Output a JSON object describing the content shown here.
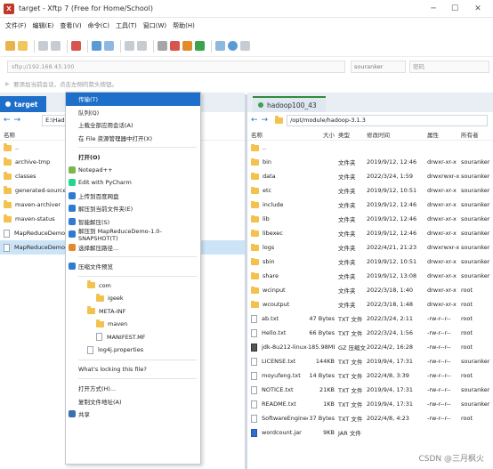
{
  "window": {
    "title": "target - Xftp 7 (Free for Home/School)",
    "app_badge": "X"
  },
  "menubar": [
    "文件(F)",
    "编辑(E)",
    "查看(V)",
    "命令(C)",
    "工具(T)",
    "窗口(W)",
    "帮助(H)"
  ],
  "address": {
    "placeholder": "sftp://192.168.43.100",
    "username_placeholder": "souranker",
    "password_placeholder": "密码"
  },
  "hint": "要添加当前会话，点击左侧的箭头按钮。",
  "left": {
    "tab_label": "target",
    "path": "E:\\HadoopC",
    "col_name": "名称",
    "items": [
      {
        "name": "..",
        "type": "folder"
      },
      {
        "name": "archive-tmp",
        "type": "folder"
      },
      {
        "name": "classes",
        "type": "folder"
      },
      {
        "name": "generated-sources",
        "type": "folder"
      },
      {
        "name": "maven-archiver",
        "type": "folder"
      },
      {
        "name": "maven-status",
        "type": "folder"
      },
      {
        "name": "MapReduceDemo-...",
        "type": "file"
      },
      {
        "name": "MapReduceDemo-...",
        "type": "file"
      }
    ]
  },
  "context_menu": {
    "groups": [
      [
        {
          "label": "传输(T)",
          "highlight": true
        },
        {
          "label": "队列(Q)"
        },
        {
          "label": "上载全部应用会话(A)"
        },
        {
          "label": "在 File 资源管理器中打开(X)"
        }
      ],
      [
        {
          "label": "打开(O)",
          "bold": true
        },
        {
          "label": "Notepad++",
          "icon": "#7bb84a"
        },
        {
          "label": "Edit with PyCharm",
          "icon": "#21d789"
        },
        {
          "label": "上传到百度网盘",
          "icon": "#2e7bd1"
        },
        {
          "label": "解压到当前文件夹(E)",
          "icon": "#2e7bd1"
        },
        {
          "label": "智能解压(S)",
          "icon": "#2e7bd1"
        },
        {
          "label": "解压到 MapReduceDemo-1.0-SNAPSHOT(T)",
          "icon": "#2e7bd1"
        },
        {
          "label": "选择解压路径...",
          "icon": "#e38a2b"
        }
      ],
      [
        {
          "label": "压缩文件预览",
          "icon": "#2e7bd1"
        }
      ],
      [
        {
          "label": "com",
          "folder": true,
          "indent": 1
        },
        {
          "label": "igeek",
          "folder": true,
          "indent": 2
        },
        {
          "label": "META-INF",
          "folder": true,
          "indent": 1
        },
        {
          "label": "maven",
          "folder": true,
          "indent": 2
        },
        {
          "label": "MANIFEST.MF",
          "file": true,
          "indent": 2
        },
        {
          "label": "log4j.properties",
          "file": true,
          "indent": 1
        }
      ],
      [
        {
          "label": "What's locking this file?"
        }
      ],
      [
        {
          "label": "打开方式(H)..."
        },
        {
          "label": "复制文件地址(A)"
        },
        {
          "label": "共享",
          "icon": "#3a6fb0"
        }
      ]
    ]
  },
  "right": {
    "tab_label": "hadoop100_43",
    "path": "/opt/module/hadoop-3.1.3",
    "columns": [
      "名称",
      "大小",
      "类型",
      "修改时间",
      "属性",
      "所有者"
    ],
    "rows": [
      {
        "name": "..",
        "size": "",
        "type": "",
        "mtime": "",
        "attr": "",
        "owner": "",
        "icon": "folder"
      },
      {
        "name": "bin",
        "size": "",
        "type": "文件夹",
        "mtime": "2019/9/12, 12:46",
        "attr": "drwxr-xr-x",
        "owner": "souranker",
        "icon": "folder"
      },
      {
        "name": "data",
        "size": "",
        "type": "文件夹",
        "mtime": "2022/3/24, 1:59",
        "attr": "drwxrwxr-x",
        "owner": "souranker",
        "icon": "folder"
      },
      {
        "name": "etc",
        "size": "",
        "type": "文件夹",
        "mtime": "2019/9/12, 10:51",
        "attr": "drwxr-xr-x",
        "owner": "souranker",
        "icon": "folder"
      },
      {
        "name": "include",
        "size": "",
        "type": "文件夹",
        "mtime": "2019/9/12, 12:46",
        "attr": "drwxr-xr-x",
        "owner": "souranker",
        "icon": "folder"
      },
      {
        "name": "lib",
        "size": "",
        "type": "文件夹",
        "mtime": "2019/9/12, 12:46",
        "attr": "drwxr-xr-x",
        "owner": "souranker",
        "icon": "folder"
      },
      {
        "name": "libexec",
        "size": "",
        "type": "文件夹",
        "mtime": "2019/9/12, 12:46",
        "attr": "drwxr-xr-x",
        "owner": "souranker",
        "icon": "folder"
      },
      {
        "name": "logs",
        "size": "",
        "type": "文件夹",
        "mtime": "2022/4/21, 21:23",
        "attr": "drwxrwxr-x",
        "owner": "souranker",
        "icon": "folder"
      },
      {
        "name": "sbin",
        "size": "",
        "type": "文件夹",
        "mtime": "2019/9/12, 10:51",
        "attr": "drwxr-xr-x",
        "owner": "souranker",
        "icon": "folder"
      },
      {
        "name": "share",
        "size": "",
        "type": "文件夹",
        "mtime": "2019/9/12, 13:08",
        "attr": "drwxr-xr-x",
        "owner": "souranker",
        "icon": "folder"
      },
      {
        "name": "wcinput",
        "size": "",
        "type": "文件夹",
        "mtime": "2022/3/18, 1:40",
        "attr": "drwxr-xr-x",
        "owner": "root",
        "icon": "folder"
      },
      {
        "name": "wcoutput",
        "size": "",
        "type": "文件夹",
        "mtime": "2022/3/18, 1:48",
        "attr": "drwxr-xr-x",
        "owner": "root",
        "icon": "folder"
      },
      {
        "name": "ab.txt",
        "size": "47 Bytes",
        "type": "TXT 文件",
        "mtime": "2022/3/24, 2:11",
        "attr": "-rw-r--r--",
        "owner": "root",
        "icon": "file"
      },
      {
        "name": "Hello.txt",
        "size": "66 Bytes",
        "type": "TXT 文件",
        "mtime": "2022/3/24, 1:56",
        "attr": "-rw-r--r--",
        "owner": "root",
        "icon": "file"
      },
      {
        "name": "jdk-8u212-linux-x64....",
        "size": "185.98MB",
        "type": "GZ 压缩文...",
        "mtime": "2022/4/2, 16:28",
        "attr": "-rw-r--r--",
        "owner": "root",
        "icon": "dark"
      },
      {
        "name": "LICENSE.txt",
        "size": "144KB",
        "type": "TXT 文件",
        "mtime": "2019/9/4, 17:31",
        "attr": "-rw-r--r--",
        "owner": "souranker",
        "icon": "file"
      },
      {
        "name": "moyufeng.txt",
        "size": "14 Bytes",
        "type": "TXT 文件",
        "mtime": "2022/4/8, 3:39",
        "attr": "-rw-r--r--",
        "owner": "root",
        "icon": "file"
      },
      {
        "name": "NOTICE.txt",
        "size": "21KB",
        "type": "TXT 文件",
        "mtime": "2019/9/4, 17:31",
        "attr": "-rw-r--r--",
        "owner": "souranker",
        "icon": "file"
      },
      {
        "name": "README.txt",
        "size": "1KB",
        "type": "TXT 文件",
        "mtime": "2019/9/4, 17:31",
        "attr": "-rw-r--r--",
        "owner": "souranker",
        "icon": "file"
      },
      {
        "name": "SoftwareEngineerin...",
        "size": "37 Bytes",
        "type": "TXT 文件",
        "mtime": "2022/4/8, 4:23",
        "attr": "-rw-r--r--",
        "owner": "root",
        "icon": "file"
      },
      {
        "name": "wordcount.jar",
        "size": "9KB",
        "type": "JAR 文件",
        "mtime": "",
        "attr": "",
        "owner": "",
        "icon": "blue"
      }
    ]
  },
  "watermark": "CSDN @三月枫火"
}
